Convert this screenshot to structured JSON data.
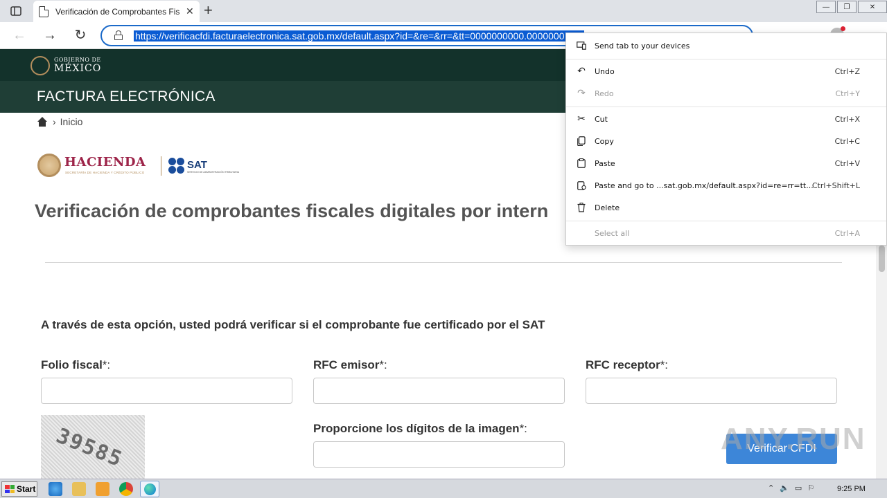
{
  "browser": {
    "tab_title": "Verificación de Comprobantes Fis",
    "url": "https://verificacfdi.facturaelectronica.sat.gob.mx/default.aspx?id=&re=&rr=&tt=0000000000.0000000"
  },
  "header": {
    "gov_line1": "GOBIERNO DE",
    "gov_line2": "MÉXICO",
    "section_title": "FACTURA ELECTRÓNICA",
    "breadcrumb": "Inicio"
  },
  "logos": {
    "hacienda": "HACIENDA",
    "hacienda_sub": "SECRETARÍA DE HACIENDA Y CRÉDITO PÚBLICO",
    "sat": "SAT",
    "sat_sub": "SERVICIO DE ADMINISTRACIÓN TRIBUTARIA"
  },
  "page": {
    "title": "Verificación de comprobantes fiscales digitales por intern",
    "intro": "A través de esta opción, usted podrá verificar si el comprobante fue certificado por el SAT"
  },
  "form": {
    "folio_label": "Folio fiscal",
    "rfc_emisor_label": "RFC emisor",
    "rfc_receptor_label": "RFC receptor",
    "captcha_label": "Proporcione los dígitos de la imagen",
    "required_mark": "*:",
    "captcha_text": "39585",
    "verify_button": "Verificar CFDI"
  },
  "context_menu": {
    "items": [
      {
        "label": "Send tab to your devices",
        "shortcut": "",
        "icon": "devices-icon",
        "disabled": false
      },
      {
        "label": "Undo",
        "shortcut": "Ctrl+Z",
        "icon": "undo-icon",
        "disabled": false
      },
      {
        "label": "Redo",
        "shortcut": "Ctrl+Y",
        "icon": "redo-icon",
        "disabled": true
      },
      {
        "label": "Cut",
        "shortcut": "Ctrl+X",
        "icon": "scissors-icon",
        "disabled": false
      },
      {
        "label": "Copy",
        "shortcut": "Ctrl+C",
        "icon": "copy-icon",
        "disabled": false
      },
      {
        "label": "Paste",
        "shortcut": "Ctrl+V",
        "icon": "paste-icon",
        "disabled": false
      },
      {
        "label": "Paste and go to ...sat.gob.mx/default.aspx?id=re=rr=tt...",
        "shortcut": "Ctrl+Shift+L",
        "icon": "paste-go-icon",
        "disabled": false
      },
      {
        "label": "Delete",
        "shortcut": "",
        "icon": "trash-icon",
        "disabled": false
      },
      {
        "label": "Select all",
        "shortcut": "Ctrl+A",
        "icon": "",
        "disabled": true
      }
    ]
  },
  "watermark": "ANY.RUN",
  "taskbar": {
    "start": "Start",
    "clock": "9:25 PM"
  },
  "colors": {
    "gov_dark": "#13322b",
    "gov_band": "#1f3e36",
    "hacienda": "#9d2449",
    "gold": "#b38e5d",
    "button": "#3d86d8",
    "url_highlight": "#0a5bd3"
  }
}
